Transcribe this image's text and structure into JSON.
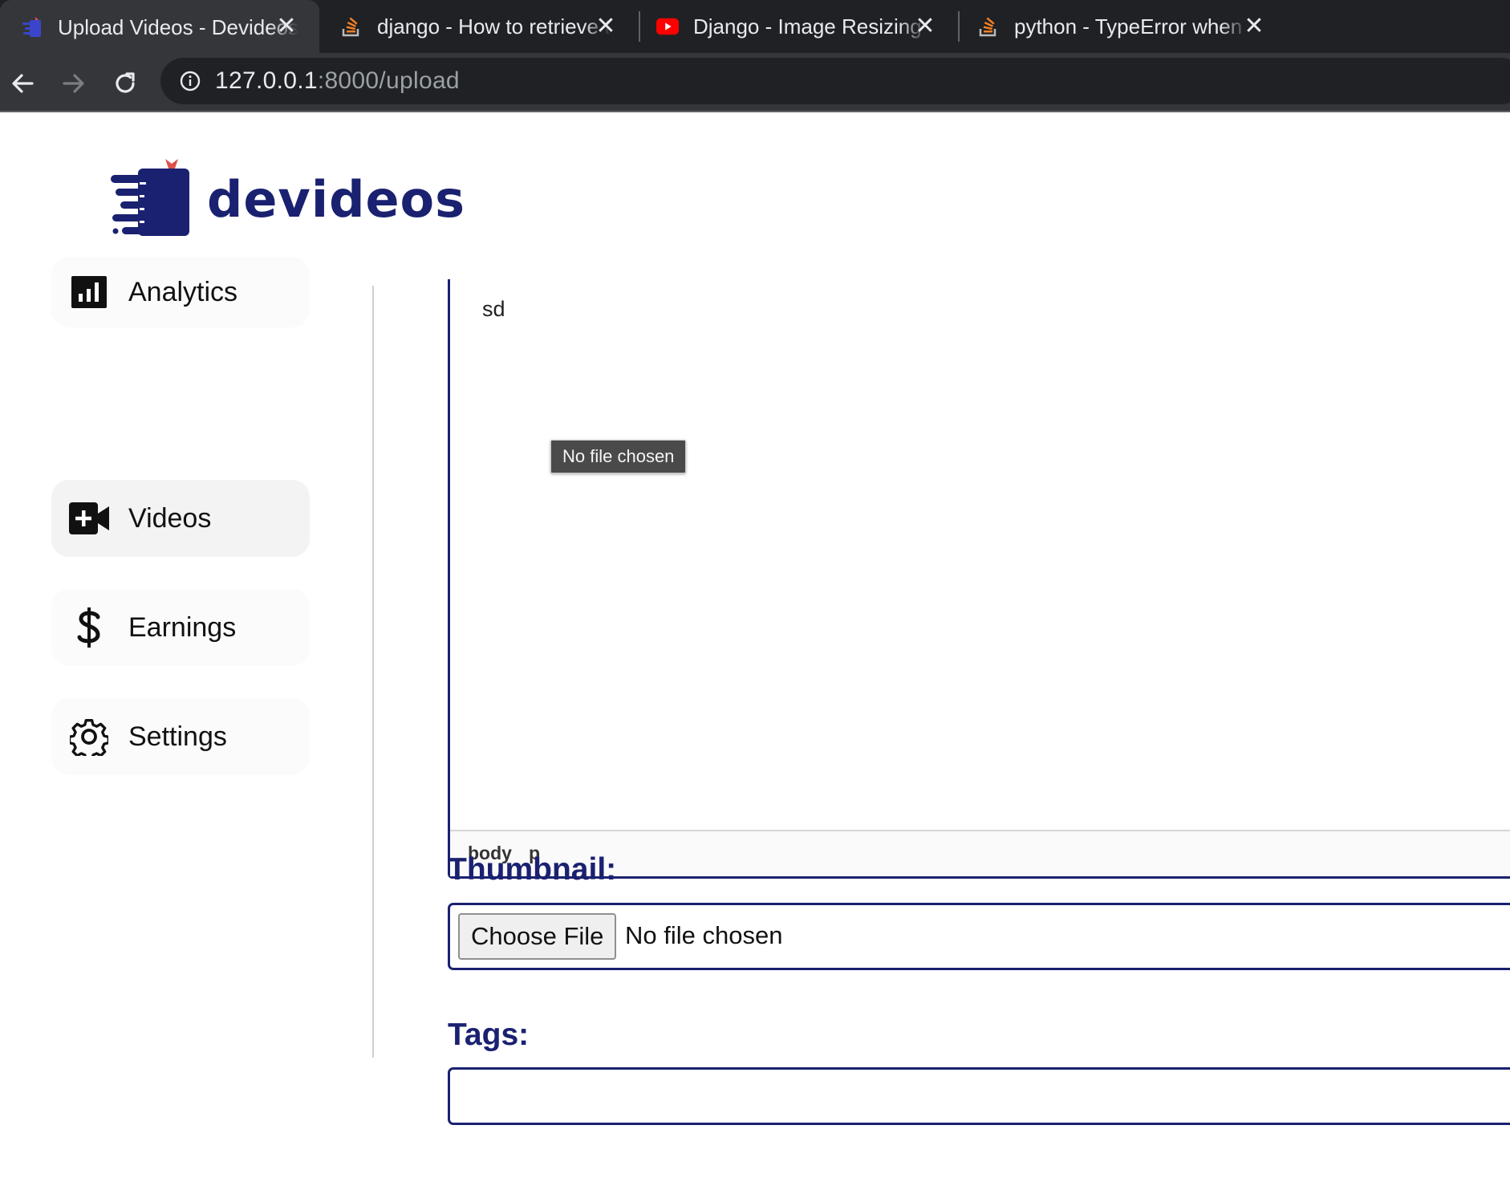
{
  "browser": {
    "tabs": [
      {
        "title": "Upload Videos - Devideos",
        "icon": "devideos-favicon",
        "active": true
      },
      {
        "title": "django - How to retrieve the first",
        "icon": "stackoverflow-favicon",
        "active": false
      },
      {
        "title": "Django - Image Resizing Before",
        "icon": "youtube-favicon",
        "active": false
      },
      {
        "title": "python - TypeError when logging",
        "icon": "stackoverflow-favicon",
        "active": false
      }
    ],
    "close_glyph": "✕",
    "url_host": "127.0.0.1",
    "url_rest": ":8000/upload"
  },
  "brand": {
    "name": "devideos",
    "color": "#1a2170",
    "accent": "#e0504a"
  },
  "sidebar": {
    "items": [
      {
        "label": "Analytics",
        "icon": "analytics-icon",
        "active": false
      },
      {
        "label": "Videos",
        "icon": "video-plus-icon",
        "active": true
      },
      {
        "label": "Earnings",
        "icon": "dollar-icon",
        "active": false
      },
      {
        "label": "Settings",
        "icon": "gear-icon",
        "active": false
      }
    ]
  },
  "editor": {
    "content": "sd",
    "path": [
      "body",
      "p"
    ]
  },
  "tooltip": "No file chosen",
  "thumbnail": {
    "label": "Thumbnail:",
    "button_label": "Choose File",
    "status": "No file chosen"
  },
  "tags": {
    "label": "Tags:",
    "value": ""
  }
}
